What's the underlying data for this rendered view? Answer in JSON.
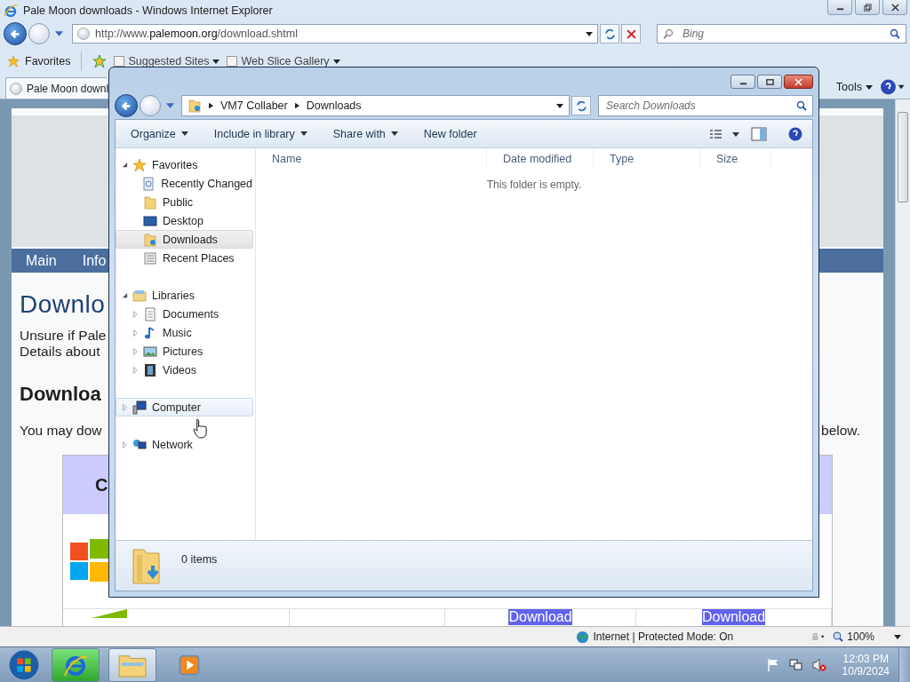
{
  "ie": {
    "title": "Pale Moon downloads - Windows Internet Explorer",
    "address": "http://www.**palemoon.org**/download.shtml",
    "search": {
      "placeholder": "Bing"
    },
    "favorites_bar": {
      "label": "Favorites",
      "links": [
        "Suggested Sites",
        "Web Slice Gallery"
      ]
    },
    "tab": {
      "label": "Pale Moon downl",
      "selected": true
    },
    "tools": "Tools",
    "page": {
      "nav": [
        "Main",
        "Info"
      ],
      "heading": "Downlo",
      "intro": [
        "Unsure if Pale",
        "Details about"
      ],
      "subheading": "Downloa",
      "text_start": "You may dow",
      "text_end": "below.",
      "table": {
        "header": "C",
        "links": [
          {
            "label": "Download",
            "selected": true
          },
          {
            "label": "Download",
            "selected": true
          }
        ]
      }
    },
    "status": {
      "zone": "Internet | Protected Mode: On",
      "zoom": "100%"
    }
  },
  "explorer": {
    "breadcrumb": [
      "VM7 Collaber",
      "Downloads"
    ],
    "search": {
      "placeholder": "Search Downloads"
    },
    "toolbar": [
      {
        "label": "Organize",
        "menu": true
      },
      {
        "label": "Include in library",
        "menu": true
      },
      {
        "label": "Share with",
        "menu": true
      },
      {
        "label": "New folder",
        "menu": false
      }
    ],
    "tree": [
      {
        "label": "Favorites",
        "expanded": true,
        "selected": false,
        "hovered": false,
        "children": [
          {
            "label": "Recently Changed",
            "selected": false,
            "hovered": false
          },
          {
            "label": "Public",
            "selected": false,
            "hovered": false
          },
          {
            "label": "Desktop",
            "selected": false,
            "hovered": false
          },
          {
            "label": "Downloads",
            "selected": true,
            "hovered": false
          },
          {
            "label": "Recent Places",
            "selected": false,
            "hovered": false
          }
        ]
      },
      {
        "label": "Libraries",
        "expanded": true,
        "selected": false,
        "hovered": false,
        "children": [
          {
            "label": "Documents",
            "expanded": false,
            "selected": false,
            "hovered": false
          },
          {
            "label": "Music",
            "expanded": false,
            "selected": false,
            "hovered": false
          },
          {
            "label": "Pictures",
            "expanded": false,
            "selected": false,
            "hovered": false
          },
          {
            "label": "Videos",
            "expanded": false,
            "selected": false,
            "hovered": false
          }
        ]
      },
      {
        "label": "Computer",
        "expanded": false,
        "selected": false,
        "hovered": true
      },
      {
        "label": "Network",
        "expanded": false,
        "selected": false,
        "hovered": false
      }
    ],
    "columns": [
      "Name",
      "Date modified",
      "Type",
      "Size"
    ],
    "empty_message": "This folder is empty.",
    "item_count": "0 items"
  },
  "taskbar": {
    "buttons": [
      {
        "active": true,
        "running": true
      },
      {
        "active": false,
        "running": true
      },
      {
        "active": false,
        "running": false
      }
    ],
    "clock": {
      "time": "12:03 PM",
      "date": "10/9/2024"
    }
  }
}
